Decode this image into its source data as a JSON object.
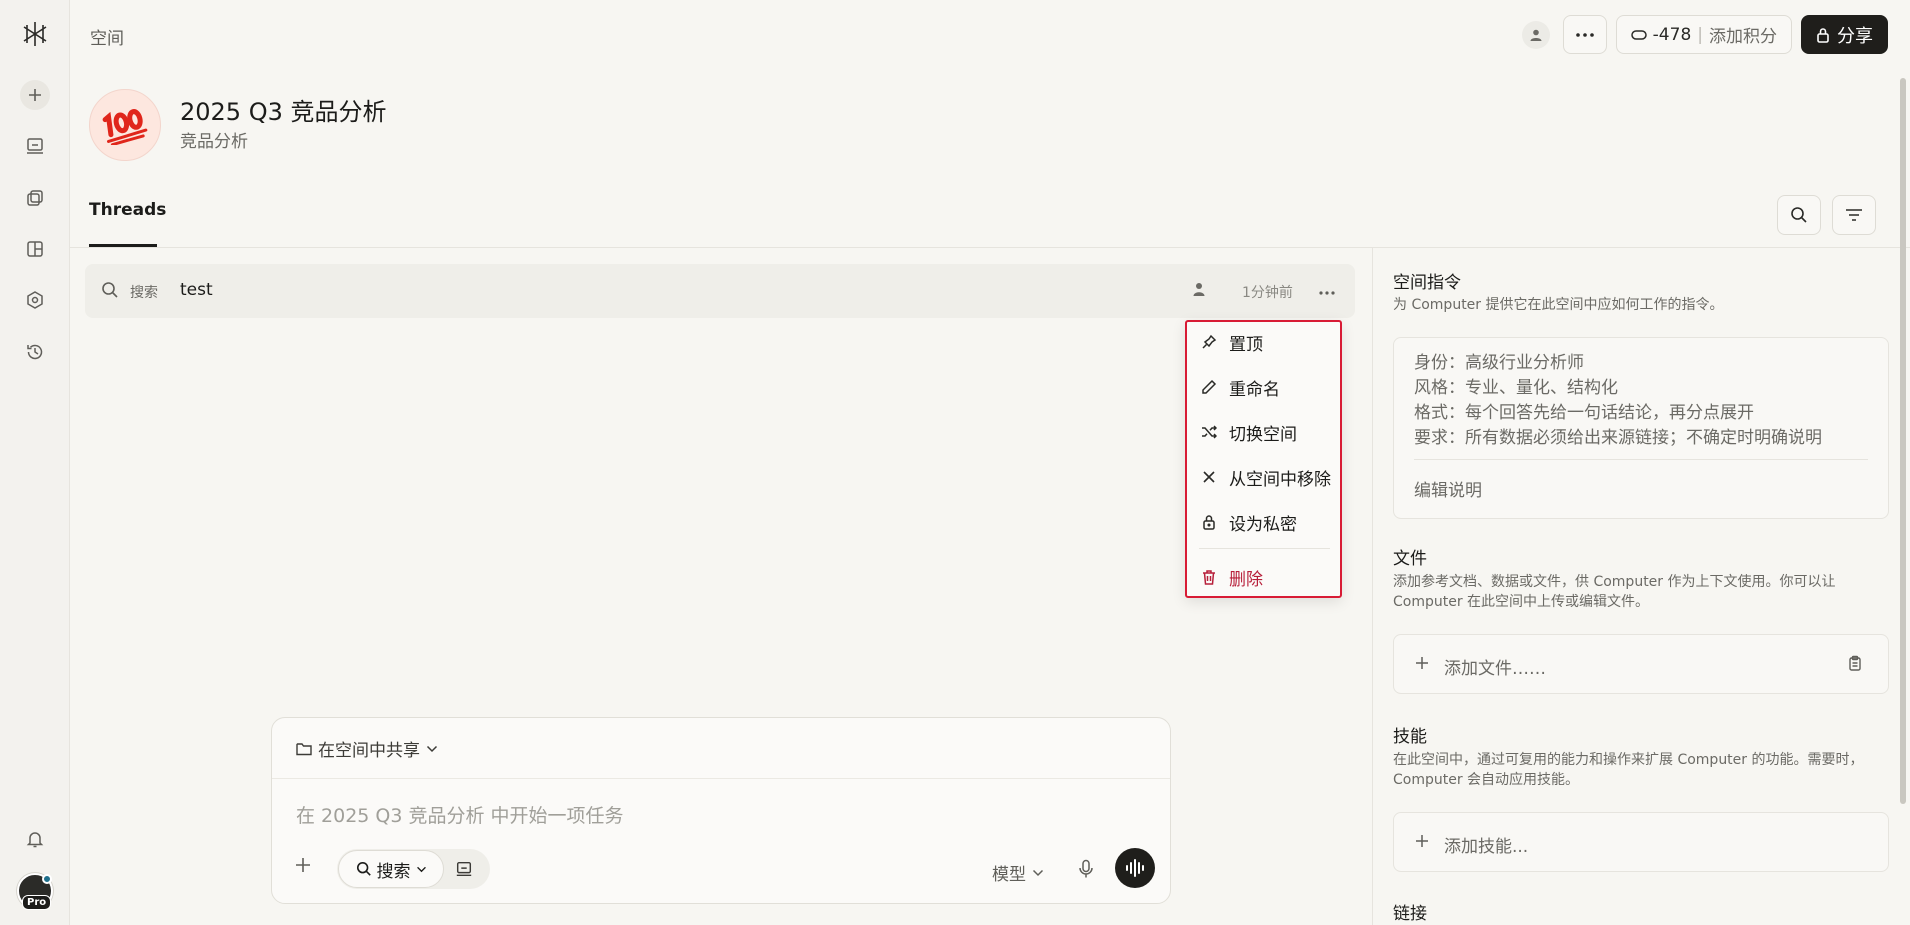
{
  "topbar": {
    "breadcrumb": "空间",
    "credits_value": "-478",
    "credits_separator": "|",
    "add_credits_label": "添加积分",
    "share_label": "分享"
  },
  "space": {
    "emoji": "💯",
    "title": "2025 Q3 竞品分析",
    "subtitle": "竞品分析"
  },
  "tabs": [
    {
      "label": "Threads",
      "active": true
    }
  ],
  "thread": {
    "search_label": "搜索",
    "title": "test",
    "time": "1分钟前"
  },
  "context_menu": {
    "items": [
      {
        "label": "置顶",
        "icon": "pin-icon"
      },
      {
        "label": "重命名",
        "icon": "pencil-icon"
      },
      {
        "label": "切换空间",
        "icon": "shuffle-icon"
      },
      {
        "label": "从空间中移除",
        "icon": "close-icon"
      },
      {
        "label": "设为私密",
        "icon": "lock-icon"
      },
      {
        "label": "删除",
        "icon": "trash-icon",
        "danger": true
      }
    ]
  },
  "composer": {
    "share_scope": "在空间中共享",
    "placeholder": "在 2025 Q3 竞品分析 中开始一项任务",
    "mode_search": "搜索",
    "model_label": "模型"
  },
  "right_panel": {
    "instructions": {
      "heading": "空间指令",
      "description": "为 Computer 提供它在此空间中应如何工作的指令。",
      "lines": [
        "身份：高级行业分析师",
        "风格：专业、量化、结构化",
        "格式：每个回答先给一句话结论，再分点展开",
        "要求：所有数据必须给出来源链接；不确定时明确说明"
      ],
      "edit_label": "编辑说明"
    },
    "files": {
      "heading": "文件",
      "description": "添加参考文档、数据或文件，供 Computer 作为上下文使用。你可以让 Computer 在此空间中上传或编辑文件。",
      "add_label": "添加文件……"
    },
    "skills": {
      "heading": "技能",
      "description": "在此空间中，通过可复用的能力和操作来扩展 Computer 的功能。需要时，Computer 会自动应用技能。",
      "add_label": "添加技能..."
    },
    "links": {
      "heading": "链接"
    }
  },
  "sidebar": {
    "badge": "Pro"
  },
  "colors": {
    "accent_danger": "#b71f3a",
    "highlight_border": "#d81b35",
    "dark_button": "#1f1e1b"
  }
}
